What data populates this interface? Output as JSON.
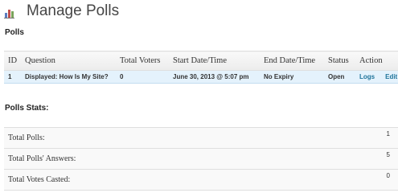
{
  "header": {
    "title": "Manage Polls"
  },
  "polls_section": {
    "heading": "Polls"
  },
  "polls_table": {
    "columns": [
      "ID",
      "Question",
      "Total Voters",
      "Start Date/Time",
      "End Date/Time",
      "Status",
      "Action"
    ],
    "rows": [
      {
        "id": "1",
        "question": "Displayed: How Is My Site?",
        "total_voters": "0",
        "start": "June 30, 2013 @ 5:07 pm",
        "end": "No Expiry",
        "status": "Open",
        "action_logs": "Logs",
        "action_edit": "Edit"
      }
    ]
  },
  "stats_section": {
    "heading": "Polls Stats:"
  },
  "stats": [
    {
      "label": "Total Polls:",
      "value": "1"
    },
    {
      "label": "Total Polls' Answers:",
      "value": "5"
    },
    {
      "label": "Total Votes Casted:",
      "value": "0"
    }
  ],
  "colors": {
    "link": "#21759b",
    "row_highlight": "#e4f2fc",
    "header_bg": "#ececec"
  },
  "icons": {
    "title_icon": "bar-chart-icon"
  }
}
